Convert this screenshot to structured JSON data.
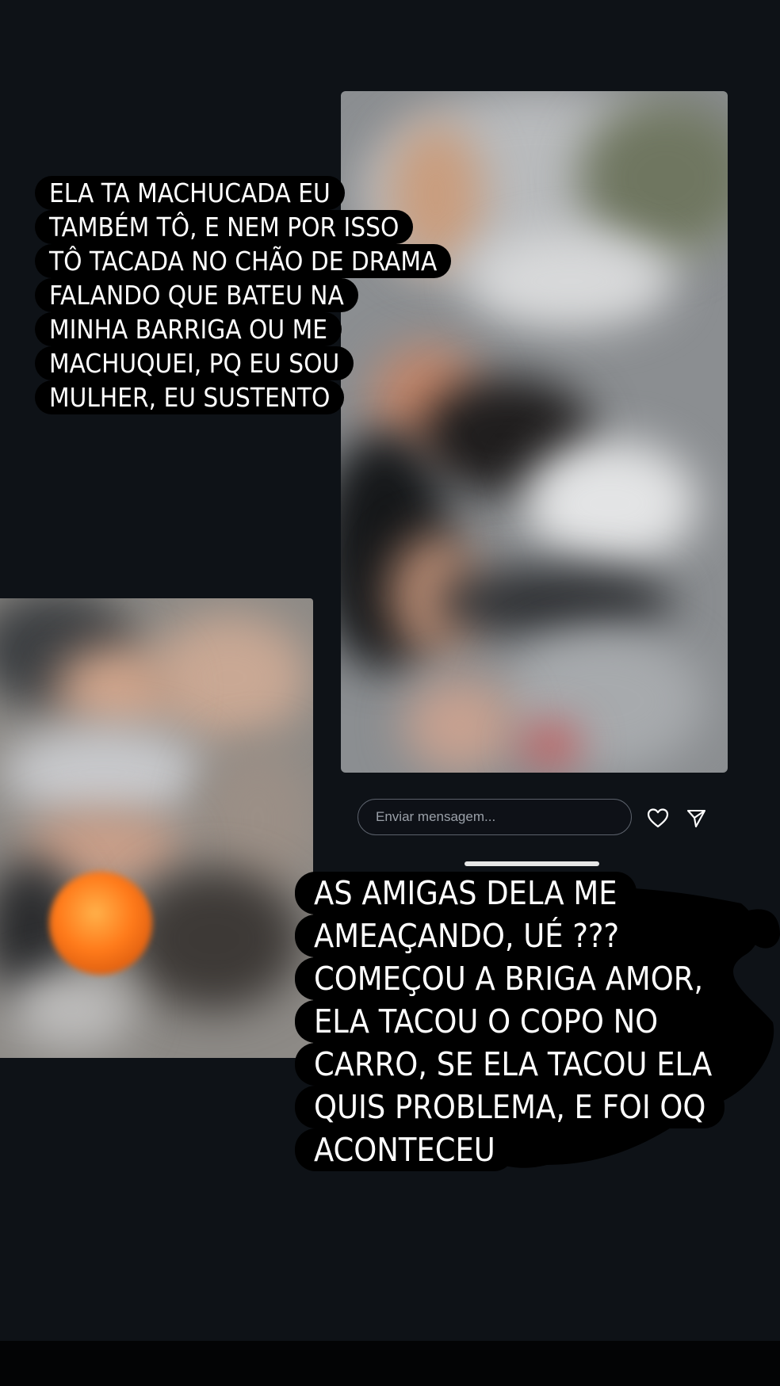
{
  "composer": {
    "placeholder": "Enviar mensagem...",
    "like_icon": "heart-icon",
    "send_icon": "paper-plane-icon"
  },
  "captions": {
    "top": [
      "ELA TA MACHUCADA EU",
      "TAMBÉM TÔ, E NEM POR ISSO",
      "TÔ TACADA NO CHÃO DE DRAMA",
      "FALANDO QUE BATEU NA",
      "MINHA BARRIGA OU ME",
      "MACHUQUEI, PQ EU SOU",
      "MULHER, EU SUSTENTO"
    ],
    "bottom": [
      "AS AMIGAS DELA ME",
      "AMEAÇANDO, UÉ ???",
      "COMEÇOU A BRIGA AMOR,",
      "ELA TACOU O COPO NO",
      "CARRO, SE ELA TACOU ELA",
      "QUIS PROBLEMA, E FOI OQ",
      "ACONTECEU"
    ]
  },
  "colors": {
    "background": "#0e1217",
    "caption_bg": "#000000",
    "caption_text": "#ffffff",
    "emoji": "#ff7a1a"
  }
}
